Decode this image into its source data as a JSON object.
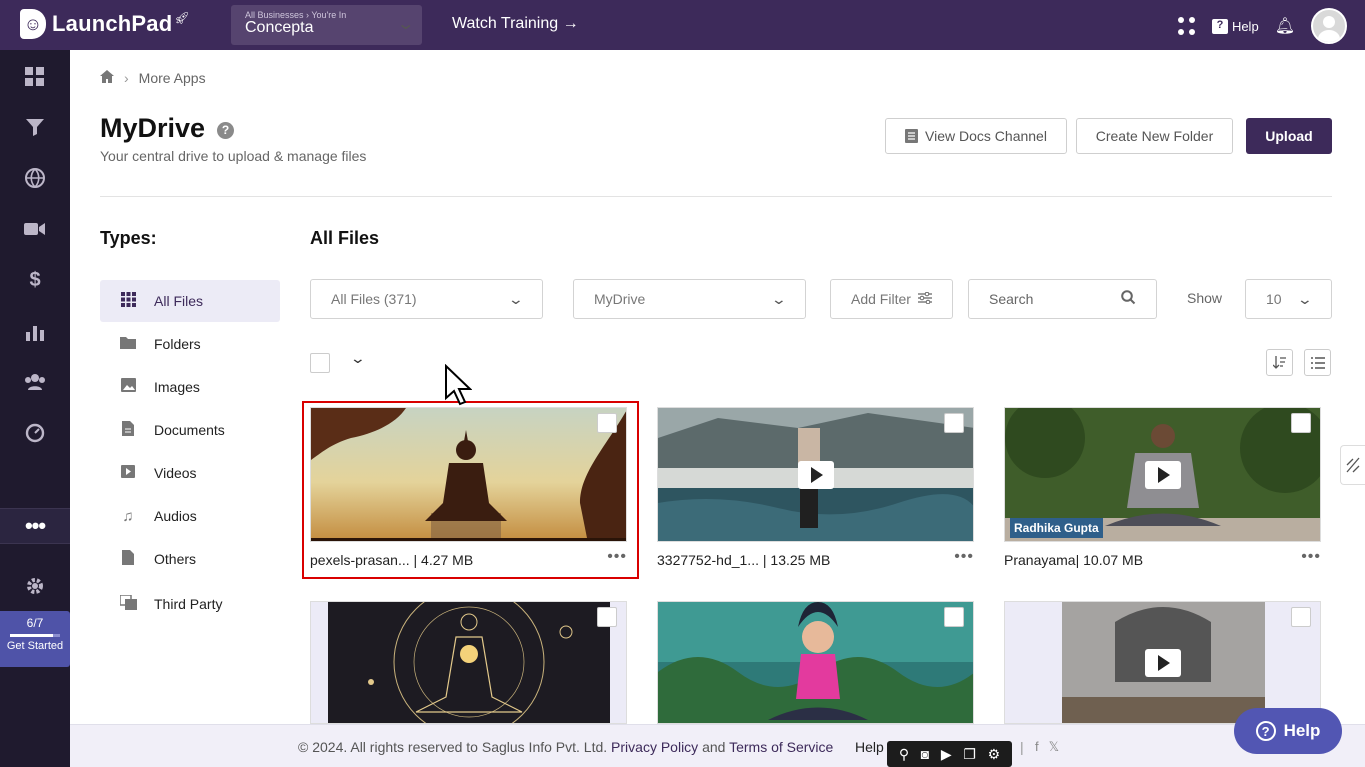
{
  "app": {
    "name": "LaunchPad"
  },
  "business": {
    "breadcrumb": "All Businesses › You're In",
    "name": "Concepta"
  },
  "topbar": {
    "watch_training": "Watch Training →",
    "help": "Help"
  },
  "icons": {
    "sidebar": [
      "dashboard-icon",
      "funnel-icon",
      "globe-icon",
      "video-icon",
      "dollar-icon",
      "analytics-icon",
      "users-icon",
      "gauge-icon",
      "more-apps-icon",
      "settings-icon"
    ]
  },
  "onboarding": {
    "count": "6/7",
    "progress": 0.857,
    "label": "Get Started"
  },
  "breadcrumb": {
    "current": "More Apps"
  },
  "page": {
    "title": "MyDrive",
    "subtitle": "Your central drive to upload & manage files"
  },
  "actions": {
    "view_docs": "View Docs Channel",
    "new_folder": "Create New Folder",
    "upload": "Upload"
  },
  "types": {
    "title": "Types:",
    "items": [
      {
        "label": "All Files",
        "icon": "grid-icon",
        "active": true
      },
      {
        "label": "Folders",
        "icon": "folder-icon"
      },
      {
        "label": "Images",
        "icon": "image-icon"
      },
      {
        "label": "Documents",
        "icon": "document-icon"
      },
      {
        "label": "Videos",
        "icon": "video-file-icon"
      },
      {
        "label": "Audios",
        "icon": "music-icon"
      },
      {
        "label": "Others",
        "icon": "file-icon"
      },
      {
        "label": "Third Party",
        "icon": "third-party-icon"
      }
    ]
  },
  "files": {
    "title": "All Files",
    "filters": {
      "type": "All Files (371)",
      "location": "MyDrive",
      "add_filter": "Add Filter",
      "search_placeholder": "Search",
      "show_label": "Show",
      "show_value": "10"
    },
    "items": [
      {
        "name": "pexels-prasan...",
        "size": "| 4.27 MB",
        "selected": true
      },
      {
        "name": "3327752-hd_1...",
        "size": "| 13.25 MB"
      },
      {
        "name": "Pranayama",
        "size": "| 10.07 MB",
        "overlay": "Radhika Gupta"
      },
      {
        "name": "",
        "size": ""
      },
      {
        "name": "",
        "size": ""
      },
      {
        "name": "",
        "size": ""
      }
    ]
  },
  "footer": {
    "copyright": "©  2024. All rights reserved to Saglus Info Pvt. Ltd.",
    "privacy": "Privacy Policy",
    "and": "and",
    "terms": "Terms of Service",
    "help_links": "Help",
    "separator": "|"
  },
  "help_widget": {
    "label": "Help"
  },
  "colors": {
    "brand": "#3d2a5a",
    "sidebar": "#1f1a2e",
    "accent": "#5256b3",
    "selection": "#d90000"
  }
}
